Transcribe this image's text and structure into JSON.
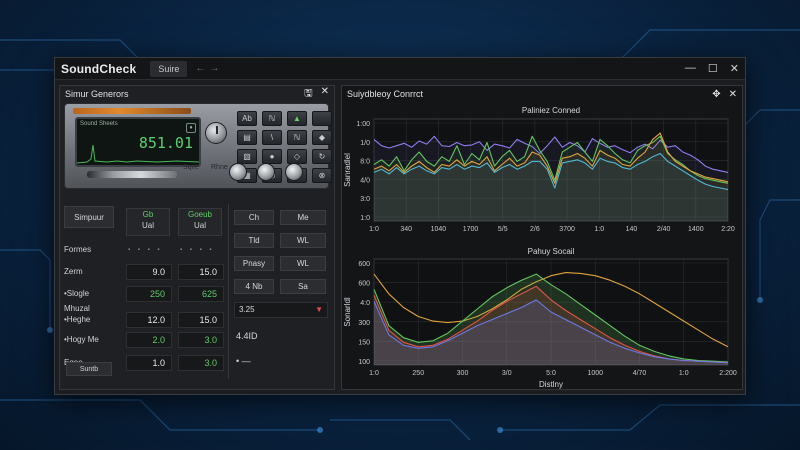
{
  "app": {
    "title": "SoundCheck",
    "tab_label": "Suire",
    "nav_back": "←",
    "nav_fwd": "→",
    "win_min": "—",
    "win_max": "☐",
    "win_close": "✕"
  },
  "left_panel": {
    "title": "Simur Generors",
    "device": {
      "screen_label": "Sound Sheets",
      "frequency": "851.01",
      "label_a": "Sqve",
      "label_b": "Rhne",
      "buttons": [
        "Ab",
        "ℕ",
        "▲",
        "",
        "▤",
        "\\",
        "ℕ",
        "◆",
        "▧",
        "●",
        "◇",
        "↻",
        "▦",
        "⬡",
        "⊘",
        "⊗",
        "⊘",
        "●",
        "⊙",
        "⊙"
      ]
    },
    "form": {
      "side_tab": "Simpuur",
      "col1": {
        "top": "Gb",
        "bottom": "Ual"
      },
      "col2": {
        "top": "Goeub",
        "bottom": "Ual"
      },
      "rows": [
        {
          "label": "Formes",
          "v1": "",
          "v2": "",
          "dots": true
        },
        {
          "label": "Zerm",
          "v1": "9.0",
          "v2": "15.0",
          "c1": "white",
          "c2": "white"
        },
        {
          "label": "•Slogle",
          "v1": "250",
          "v2": "625",
          "c1": "green",
          "c2": "green"
        },
        {
          "label": "Mhuzal",
          "v1": "",
          "v2": "",
          "dots": false
        },
        {
          "label": "•Heghe",
          "v1": "12.0",
          "v2": "15.0",
          "c1": "white",
          "c2": "white"
        },
        {
          "label": "•Hogy Me",
          "v1": "2.0",
          "v2": "3.0",
          "c1": "green",
          "c2": "green"
        },
        {
          "label": "Egee",
          "v1": "1.0",
          "v2": "3.0",
          "c1": "white",
          "c2": "green"
        }
      ],
      "bottom_button": "Suntb"
    },
    "mid": {
      "btn_ch": "Ch",
      "btn_me": "Me",
      "btn_tld": "Tld",
      "btn_wl1": "WL",
      "btn_pnasy": "Pnasy",
      "btn_wl2": "WL",
      "sel_label": "4 Nb",
      "sel_value": "Sa",
      "val_325": "3.25",
      "val_4410": "4.4ID",
      "val_arrow": "• —"
    }
  },
  "right_panel": {
    "title": "Suiydbleoy Conrrct",
    "move_icon": "✥",
    "close_icon": "✕"
  },
  "chart_data": [
    {
      "type": "line",
      "title": "Paliniez Conned",
      "ylabel": "Sanradlel",
      "xlabel": "",
      "x_ticks": [
        "1:0",
        "340",
        "1040",
        "1700",
        "5/5",
        "2/6",
        "3700",
        "1:0",
        "140",
        "2/40",
        "1400",
        "2:20"
      ],
      "y_ticks": [
        "1:00",
        "1/0",
        "8:0",
        "4/0",
        "3:0",
        "1:0"
      ],
      "ylim": [
        0,
        1300
      ],
      "grid": true,
      "series": [
        {
          "color": "#8e7cf0",
          "values": [
            1040,
            960,
            930,
            960,
            990,
            940,
            1020,
            980,
            1080,
            960,
            950,
            1000,
            960,
            970,
            1010,
            900,
            980,
            960,
            930,
            1040,
            990,
            950,
            860,
            960,
            1070,
            940,
            1000,
            960,
            880,
            1050,
            990,
            940,
            960,
            910,
            870,
            940,
            980,
            920,
            1030,
            940,
            960,
            880,
            840,
            780,
            700,
            660,
            640,
            620
          ]
        },
        {
          "color": "#62c55e",
          "values": [
            720,
            780,
            700,
            820,
            640,
            780,
            880,
            760,
            700,
            820,
            760,
            960,
            720,
            860,
            780,
            1000,
            700,
            820,
            900,
            760,
            820,
            1080,
            900,
            760,
            520,
            880,
            940,
            1000,
            880,
            760,
            1040,
            960,
            860,
            780,
            740,
            900,
            960,
            1000,
            1080,
            860,
            780,
            720,
            640,
            580,
            540,
            520,
            500,
            480
          ]
        },
        {
          "color": "#e0a43a",
          "values": [
            660,
            700,
            640,
            720,
            620,
            700,
            760,
            680,
            620,
            720,
            700,
            780,
            700,
            760,
            720,
            820,
            640,
            720,
            800,
            700,
            740,
            880,
            840,
            700,
            480,
            800,
            820,
            860,
            800,
            700,
            900,
            840,
            800,
            720,
            700,
            800,
            880,
            1040,
            1120,
            880,
            760,
            700,
            640,
            600,
            560,
            540,
            520,
            500
          ]
        },
        {
          "color": "#4fb8d6",
          "values": [
            620,
            660,
            600,
            680,
            600,
            660,
            700,
            640,
            600,
            680,
            660,
            720,
            660,
            700,
            680,
            740,
            620,
            680,
            720,
            660,
            700,
            760,
            760,
            660,
            420,
            740,
            760,
            780,
            740,
            660,
            800,
            760,
            740,
            680,
            660,
            720,
            760,
            820,
            860,
            760,
            700,
            640,
            580,
            520,
            470,
            440,
            420,
            400
          ]
        }
      ]
    },
    {
      "type": "area",
      "title": "Pahuy Socail",
      "ylabel": "Sonarldl",
      "xlabel": "Distlny",
      "x_ticks": [
        "1:0",
        "250",
        "300",
        "3/0",
        "5:0",
        "1000",
        "4/70",
        "1:0",
        "2:200"
      ],
      "y_ticks": [
        "600",
        "600",
        "4:0",
        "300",
        "150",
        "100"
      ],
      "ylim": [
        0,
        700
      ],
      "grid": true,
      "series": [
        {
          "color": "#e0a43a",
          "values": [
            600,
            470,
            380,
            320,
            290,
            280,
            290,
            320,
            370,
            430,
            500,
            550,
            590,
            610,
            605,
            590,
            560,
            520,
            470,
            410,
            350,
            290,
            230,
            170,
            120
          ]
        },
        {
          "color": "#62c55e",
          "values": [
            500,
            260,
            180,
            150,
            160,
            210,
            290,
            370,
            450,
            510,
            560,
            600,
            530,
            470,
            400,
            330,
            260,
            190,
            130,
            90,
            60,
            40,
            30,
            25,
            20
          ]
        },
        {
          "color": "#e3524a",
          "values": [
            460,
            230,
            150,
            120,
            130,
            170,
            230,
            290,
            360,
            420,
            470,
            520,
            430,
            360,
            300,
            240,
            180,
            130,
            90,
            60,
            40,
            30,
            25,
            20,
            15
          ]
        },
        {
          "color": "#6b78e8",
          "values": [
            420,
            200,
            130,
            110,
            120,
            160,
            210,
            260,
            300,
            340,
            380,
            430,
            350,
            300,
            250,
            200,
            150,
            110,
            80,
            55,
            40,
            30,
            25,
            20,
            15
          ]
        }
      ]
    }
  ]
}
